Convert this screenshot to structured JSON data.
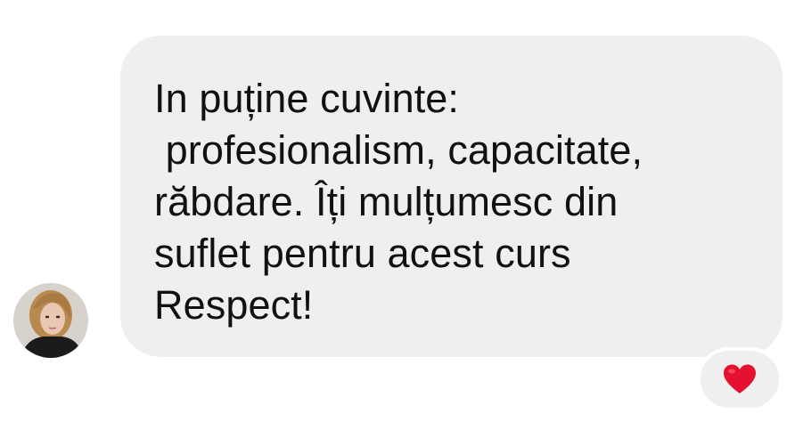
{
  "message": {
    "lines": [
      "In puține cuvinte:",
      " profesionalism, capacitate,",
      "răbdare. Îți mulțumesc din",
      "suflet pentru acest curs",
      "Respect!"
    ]
  },
  "reaction": {
    "icon": "heart-icon",
    "color": "#e5112e"
  },
  "colors": {
    "bubble": "#efefef",
    "text": "#111111"
  }
}
